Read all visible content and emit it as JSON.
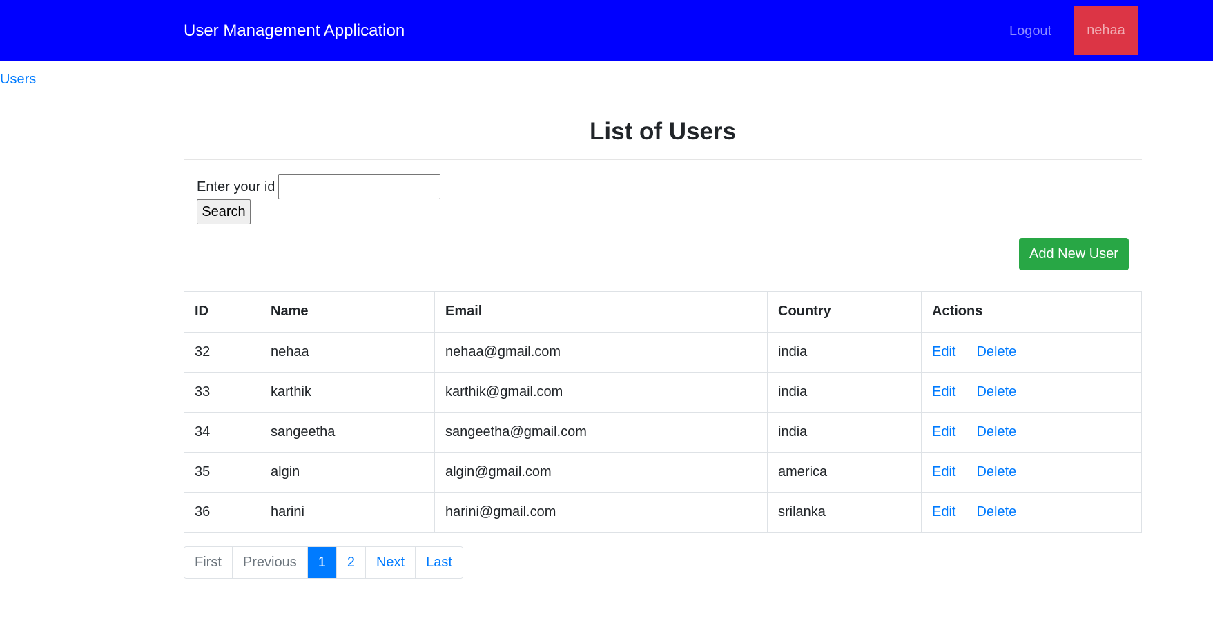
{
  "navbar": {
    "brand": "User Management Application",
    "logout": "Logout",
    "user": "nehaa"
  },
  "breadcrumb": "Users",
  "page_title": "List of Users",
  "search": {
    "label": "Enter your id",
    "value": "",
    "button": "Search"
  },
  "add_button": "Add New User",
  "table": {
    "headers": [
      "ID",
      "Name",
      "Email",
      "Country",
      "Actions"
    ],
    "rows": [
      {
        "id": "32",
        "name": "nehaa",
        "email": "nehaa@gmail.com",
        "country": "india",
        "edit": "Edit",
        "delete": "Delete"
      },
      {
        "id": "33",
        "name": "karthik",
        "email": "karthik@gmail.com",
        "country": "india",
        "edit": "Edit",
        "delete": "Delete"
      },
      {
        "id": "34",
        "name": "sangeetha",
        "email": "sangeetha@gmail.com",
        "country": "india",
        "edit": "Edit",
        "delete": "Delete"
      },
      {
        "id": "35",
        "name": "algin",
        "email": "algin@gmail.com",
        "country": "america",
        "edit": "Edit",
        "delete": "Delete"
      },
      {
        "id": "36",
        "name": "harini",
        "email": "harini@gmail.com",
        "country": "srilanka",
        "edit": "Edit",
        "delete": "Delete"
      }
    ]
  },
  "pagination": {
    "first": "First",
    "previous": "Previous",
    "pages": [
      "1",
      "2"
    ],
    "current": "1",
    "next": "Next",
    "last": "Last"
  },
  "colors": {
    "navbar": "#0000ff",
    "user_badge": "#dc3545",
    "link": "#007bff",
    "add_button": "#28a745"
  }
}
